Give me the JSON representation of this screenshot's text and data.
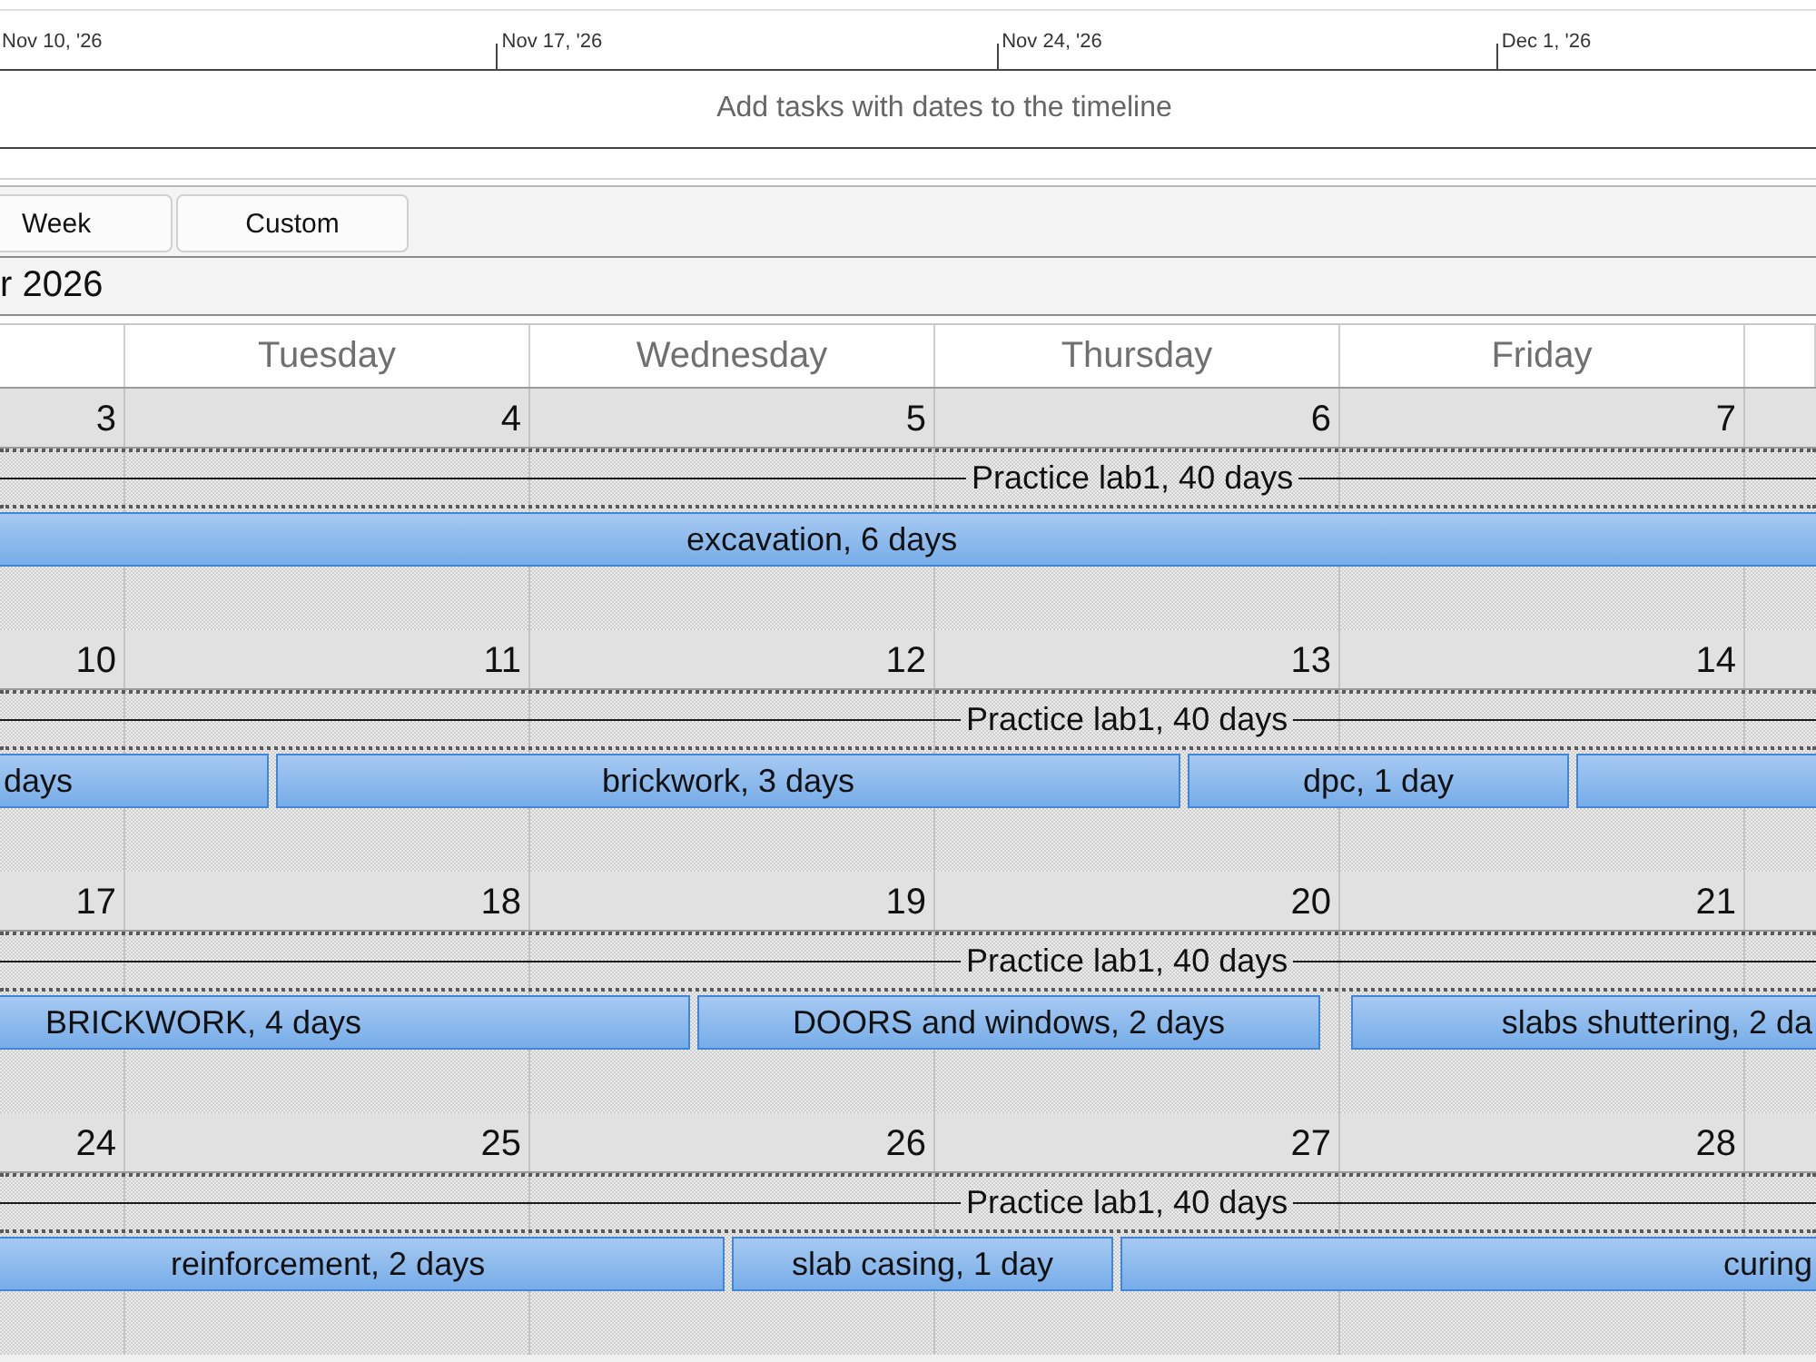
{
  "timeline": {
    "dates": [
      {
        "label": "Nov 10, '26"
      },
      {
        "label": "Nov 17, '26"
      },
      {
        "label": "Nov 24, '26"
      },
      {
        "label": "Dec 1, '26"
      }
    ],
    "empty_message": "Add tasks with dates to the timeline"
  },
  "view_buttons": [
    {
      "label": "Week"
    },
    {
      "label": "Custom"
    }
  ],
  "calendar": {
    "month_title": "r 2026",
    "day_headers": [
      "Tuesday",
      "Wednesday",
      "Thursday",
      "Friday"
    ],
    "weeks": [
      {
        "dates": [
          "3",
          "4",
          "5",
          "6",
          "7"
        ],
        "summary": "Practice lab1, 40 days",
        "tasks": [
          {
            "kind": "task",
            "label": "excavation, 6 days"
          }
        ]
      },
      {
        "dates": [
          "10",
          "11",
          "12",
          "13",
          "14"
        ],
        "summary": "Practice lab1, 40 days",
        "tasks": [
          {
            "kind": "task",
            "label": "days"
          },
          {
            "kind": "task",
            "label": "brickwork, 3 days"
          },
          {
            "kind": "task",
            "label": "dpc, 1 day"
          },
          {
            "kind": "task"
          }
        ]
      },
      {
        "dates": [
          "17",
          "18",
          "19",
          "20",
          "21"
        ],
        "summary": "Practice lab1, 40 days",
        "tasks": [
          {
            "kind": "task",
            "label": "BRICKWORK, 4 days"
          },
          {
            "kind": "task",
            "label": "DOORS and windows, 2 days"
          },
          {
            "kind": "task",
            "label": "slabs shuttering, 2 da"
          }
        ]
      },
      {
        "dates": [
          "24",
          "25",
          "26",
          "27",
          "28"
        ],
        "summary": "Practice lab1, 40 days",
        "tasks": [
          {
            "kind": "task",
            "label": "reinforcement, 2 days"
          },
          {
            "kind": "task",
            "label": "slab casing, 1 day"
          },
          {
            "kind": "task",
            "label": "curing"
          }
        ]
      }
    ]
  }
}
